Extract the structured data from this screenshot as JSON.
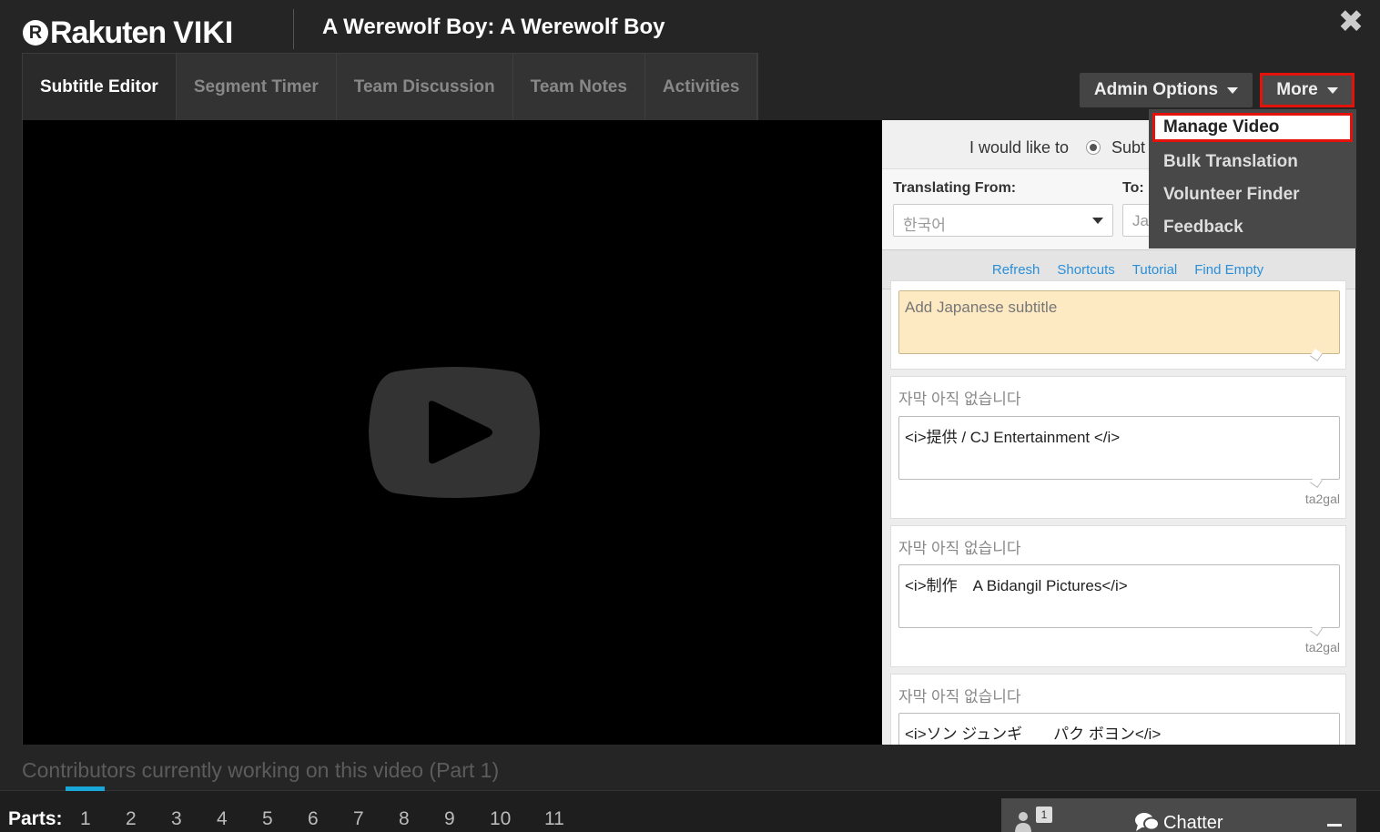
{
  "header": {
    "logo_rakuten": "Rakuten",
    "logo_viki": "VIKI",
    "title": "A Werewolf Boy: A Werewolf Boy",
    "close": "✖"
  },
  "tabs": [
    {
      "label": "Subtitle Editor",
      "active": true
    },
    {
      "label": "Segment Timer"
    },
    {
      "label": "Team Discussion"
    },
    {
      "label": "Team Notes"
    },
    {
      "label": "Activities"
    }
  ],
  "admin_options": "Admin Options",
  "more": "More",
  "more_menu": [
    "Manage Video",
    "Bulk Translation",
    "Volunteer Finder",
    "Feedback"
  ],
  "panel": {
    "would_like": "I would like to",
    "option_partial": "Subt",
    "from_label": "Translating From:",
    "to_label": "To:",
    "from_value": "한국어",
    "to_value": "Ja",
    "links": [
      "Refresh",
      "Shortcuts",
      "Tutorial",
      "Find Empty"
    ],
    "cards": [
      {
        "placeholder": "Add Japanese subtitle"
      },
      {
        "source": "자막 아직 없습니다",
        "text": "<i>提供 / CJ Entertainment </i>",
        "author": "ta2gal"
      },
      {
        "source": "자막 아직 없습니다",
        "text": "<i>制作　A Bidangil Pictures</i>",
        "author": "ta2gal"
      },
      {
        "source": "자막 아직 없습니다",
        "text": "<i>ソン ジュンギ　　パク ボヨン</i>"
      }
    ]
  },
  "contributors": "Contributors currently working on this video (Part 1)",
  "parts_label": "Parts:",
  "parts": [
    "1",
    "2",
    "3",
    "4",
    "5",
    "6",
    "7",
    "8",
    "9",
    "10",
    "11"
  ],
  "chatter": {
    "count": "1",
    "label": "Chatter"
  },
  "colors": {
    "accent_red": "#e3120b",
    "link_blue": "#2a8fd8",
    "indicator": "#19a6d8"
  }
}
